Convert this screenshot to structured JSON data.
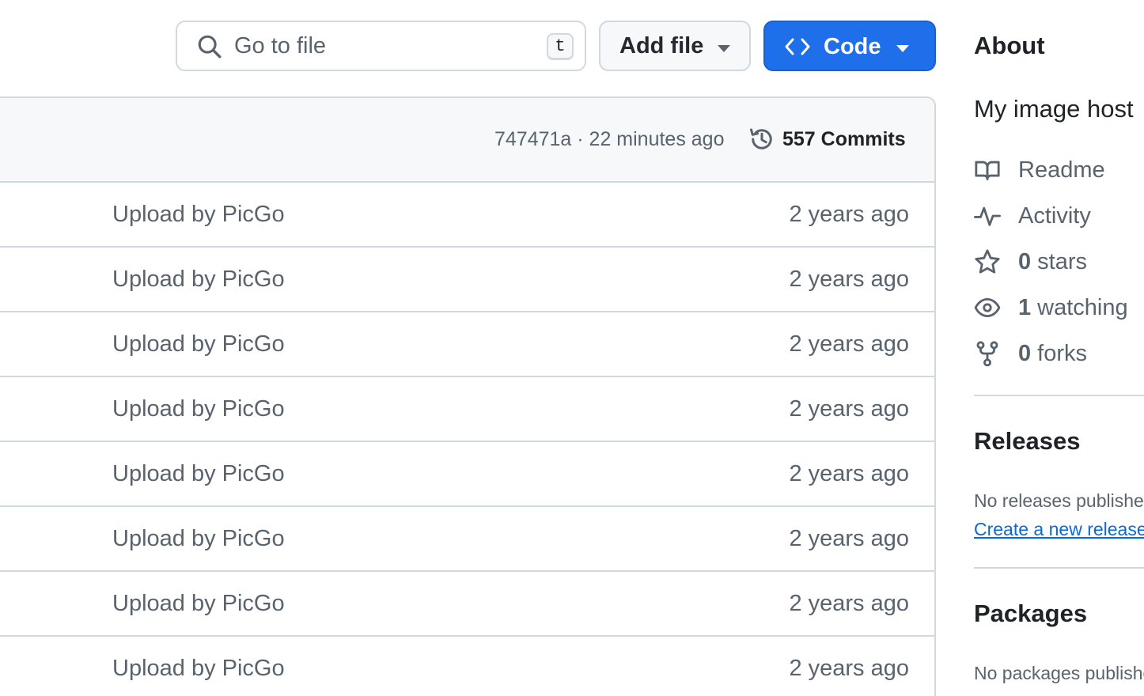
{
  "search": {
    "placeholder": "Go to file",
    "shortcut": "t"
  },
  "toolbar": {
    "add_file_label": "Add file",
    "code_label": "Code"
  },
  "commit_bar": {
    "meta": "747471a · 22 minutes ago",
    "commits_label": "557 Commits"
  },
  "rows": [
    {
      "message": "Upload by PicGo",
      "age": "2 years ago"
    },
    {
      "message": "Upload by PicGo",
      "age": "2 years ago"
    },
    {
      "message": "Upload by PicGo",
      "age": "2 years ago"
    },
    {
      "message": "Upload by PicGo",
      "age": "2 years ago"
    },
    {
      "message": "Upload by PicGo",
      "age": "2 years ago"
    },
    {
      "message": "Upload by PicGo",
      "age": "2 years ago"
    },
    {
      "message": "Upload by PicGo",
      "age": "2 years ago"
    },
    {
      "message": "Upload by PicGo",
      "age": "2 years ago"
    }
  ],
  "about": {
    "title": "About",
    "description": "My image host",
    "readme": "Readme",
    "activity": "Activity",
    "stars_count": "0",
    "stars_label": "stars",
    "watching_count": "1",
    "watching_label": "watching",
    "forks_count": "0",
    "forks_label": "forks"
  },
  "releases": {
    "title": "Releases",
    "empty_text": "No releases published",
    "create_link": "Create a new release"
  },
  "packages": {
    "title": "Packages",
    "empty_text": "No packages published"
  },
  "colors": {
    "accent": "#1f6feb",
    "link": "#0969da",
    "muted": "#59636e",
    "border": "#d1d9e0"
  }
}
